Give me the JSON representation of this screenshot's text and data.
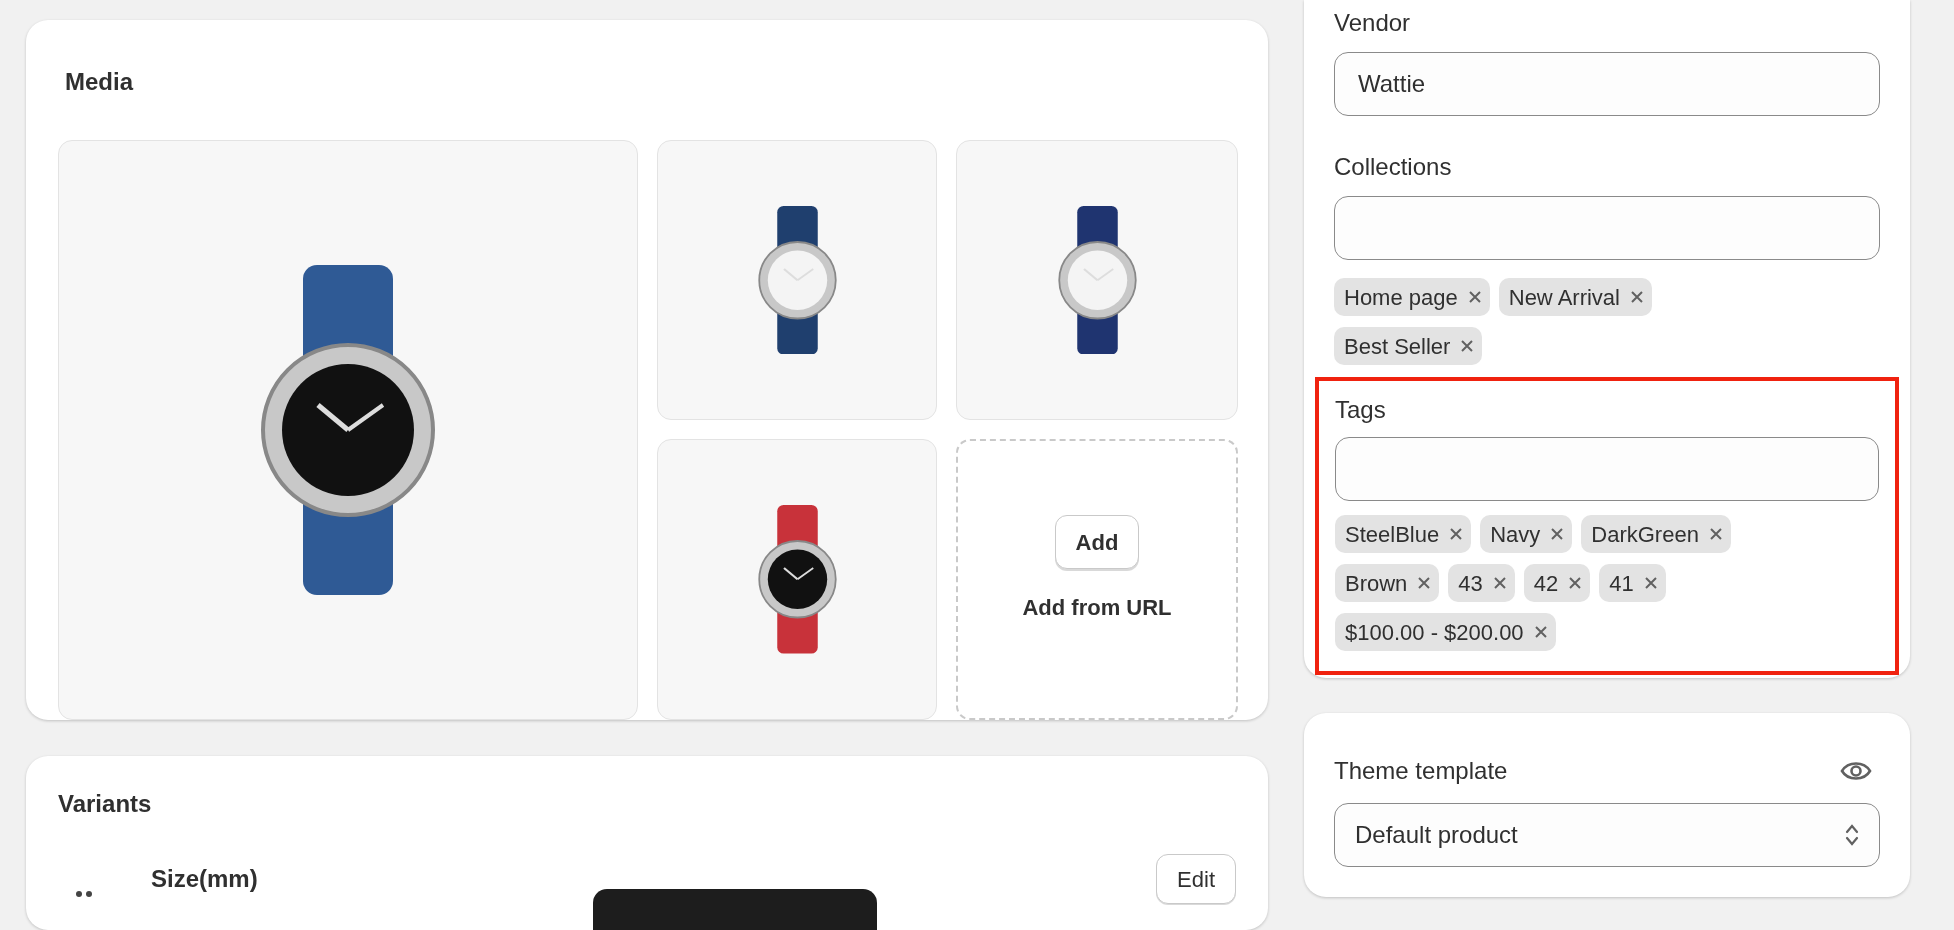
{
  "media": {
    "title": "Media",
    "items": [
      {
        "kind": "photo",
        "color": "#2f5a95"
      },
      {
        "kind": "photo",
        "color": "#1f3f6e"
      },
      {
        "kind": "photo",
        "color": "#1f3470"
      },
      {
        "kind": "photo",
        "color": "#c8323a"
      },
      {
        "kind": "add",
        "button": "Add",
        "link": "Add from URL"
      }
    ]
  },
  "variants": {
    "title": "Variants",
    "option": "Size(mm)",
    "edit": "Edit"
  },
  "organization": {
    "vendor": {
      "label": "Vendor",
      "value": "Wattie"
    },
    "collections": {
      "label": "Collections",
      "chips": [
        "Home page",
        "New Arrival",
        "Best Seller"
      ]
    },
    "tags": {
      "label": "Tags",
      "highlighted": true,
      "chips": [
        "SteelBlue",
        "Navy",
        "DarkGreen",
        "Brown",
        "43",
        "42",
        "41",
        "$100.00 - $200.00"
      ]
    }
  },
  "theme_template": {
    "label": "Theme template",
    "value": "Default product"
  }
}
